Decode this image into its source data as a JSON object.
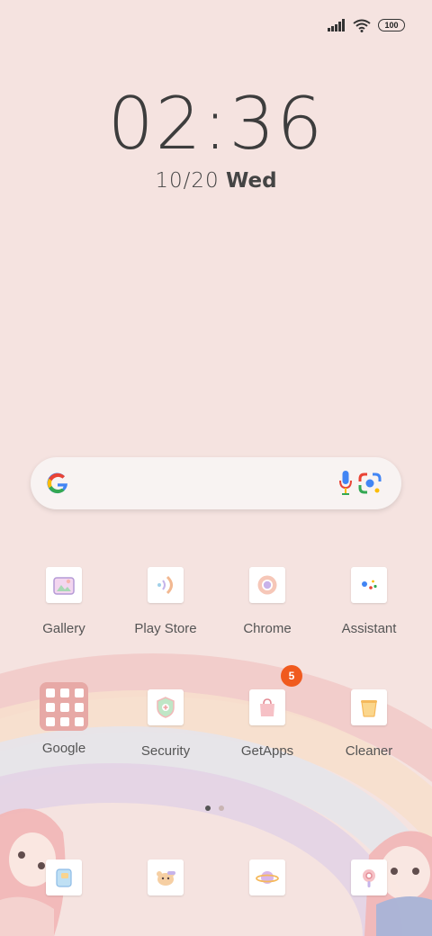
{
  "status_bar": {
    "battery_level": "100",
    "icons": [
      "signal-icon",
      "wifi-icon",
      "battery-icon"
    ]
  },
  "lock": {
    "time": "02:36",
    "date_num": "10/20",
    "day": "Wed"
  },
  "search": {
    "icons": [
      "google-logo-icon",
      "mic-icon",
      "lens-icon"
    ]
  },
  "apps_row1": [
    {
      "label": "Gallery"
    },
    {
      "label": "Play Store"
    },
    {
      "label": "Chrome"
    },
    {
      "label": "Assistant"
    }
  ],
  "apps_row2": [
    {
      "label": "Google"
    },
    {
      "label": "Security"
    },
    {
      "label": "GetApps",
      "badge": "5"
    },
    {
      "label": "Cleaner"
    }
  ],
  "dock": {
    "icons": [
      "messages-icon",
      "bear-icon",
      "planet-icon",
      "camera-icon"
    ]
  },
  "page_indicator": {
    "pages": 2,
    "current": 1
  },
  "colors": {
    "background": "#f5e3e0",
    "badge": "#f05a1e",
    "folder": "#e7a9a6"
  }
}
